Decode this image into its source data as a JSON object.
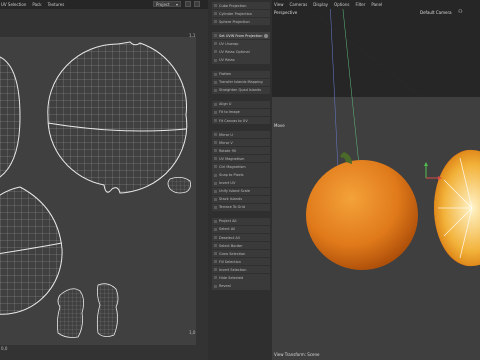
{
  "menubar": {
    "items": [
      "UV Selection",
      "Pack",
      "Textures"
    ],
    "mode_select": "Project"
  },
  "uv_editor": {
    "corner_tr": "1,1",
    "corner_bl": "0,0",
    "corner_br": "1,0"
  },
  "commands": {
    "items": [
      {
        "label": "Cube Projection",
        "active": false
      },
      {
        "label": "Cylinder Projection",
        "active": false
      },
      {
        "label": "Sphere Projection",
        "active": false
      },
      {
        "gap": true
      },
      {
        "label": "Set UVW From Projection",
        "active": true,
        "toggle": true
      },
      {
        "label": "UV Unwrap",
        "active": false
      },
      {
        "label": "UV Relax Optimal",
        "active": false
      },
      {
        "label": "UV Relax",
        "active": false
      },
      {
        "gap": true
      },
      {
        "label": "Flatten",
        "active": false
      },
      {
        "label": "Transfer Islands Mapping",
        "active": false
      },
      {
        "label": "Straighten Quad Islands",
        "active": false
      },
      {
        "gap": true
      },
      {
        "label": "Align U",
        "active": false
      },
      {
        "label": "Fit to Image",
        "active": false
      },
      {
        "label": "Fit Canvas to UV",
        "active": false
      },
      {
        "gap": true
      },
      {
        "label": "Mirror U",
        "active": false
      },
      {
        "label": "Mirror V",
        "active": false
      },
      {
        "label": "Rotate 90",
        "active": false
      },
      {
        "label": "UV Magnetism",
        "active": false
      },
      {
        "label": "Ctrl Magnetism",
        "active": false
      },
      {
        "label": "Snap to Pixels",
        "active": false
      },
      {
        "label": "Invert UV",
        "active": false
      },
      {
        "label": "Unify Island Scale",
        "active": false
      },
      {
        "label": "Stack Islands",
        "active": false
      },
      {
        "label": "Terrace To Grid",
        "active": false
      },
      {
        "gap": true
      },
      {
        "label": "Project All",
        "active": false
      },
      {
        "label": "Select All",
        "active": false
      },
      {
        "label": "Deselect All",
        "active": false
      },
      {
        "label": "Select Border",
        "active": false
      },
      {
        "label": "Grow Selection",
        "active": false
      },
      {
        "label": "Fill Selection",
        "active": false
      },
      {
        "label": "Invert Selection",
        "active": false
      },
      {
        "label": "Hide Selected",
        "active": false
      },
      {
        "label": "Reveal",
        "active": false
      }
    ]
  },
  "viewport": {
    "menu": [
      "View",
      "Cameras",
      "Display",
      "Options",
      "Filter",
      "Panel"
    ],
    "view_name": "Perspective",
    "camera": "Default Camera",
    "camera_icon": "camera-icon",
    "side_label": "Move",
    "status": "View Transform: Scene"
  },
  "colors": {
    "orange": "#e07a1a",
    "orange_dark": "#a84a08",
    "uv_lines": "#e8e8e8",
    "stem": "#4a6a2a"
  }
}
